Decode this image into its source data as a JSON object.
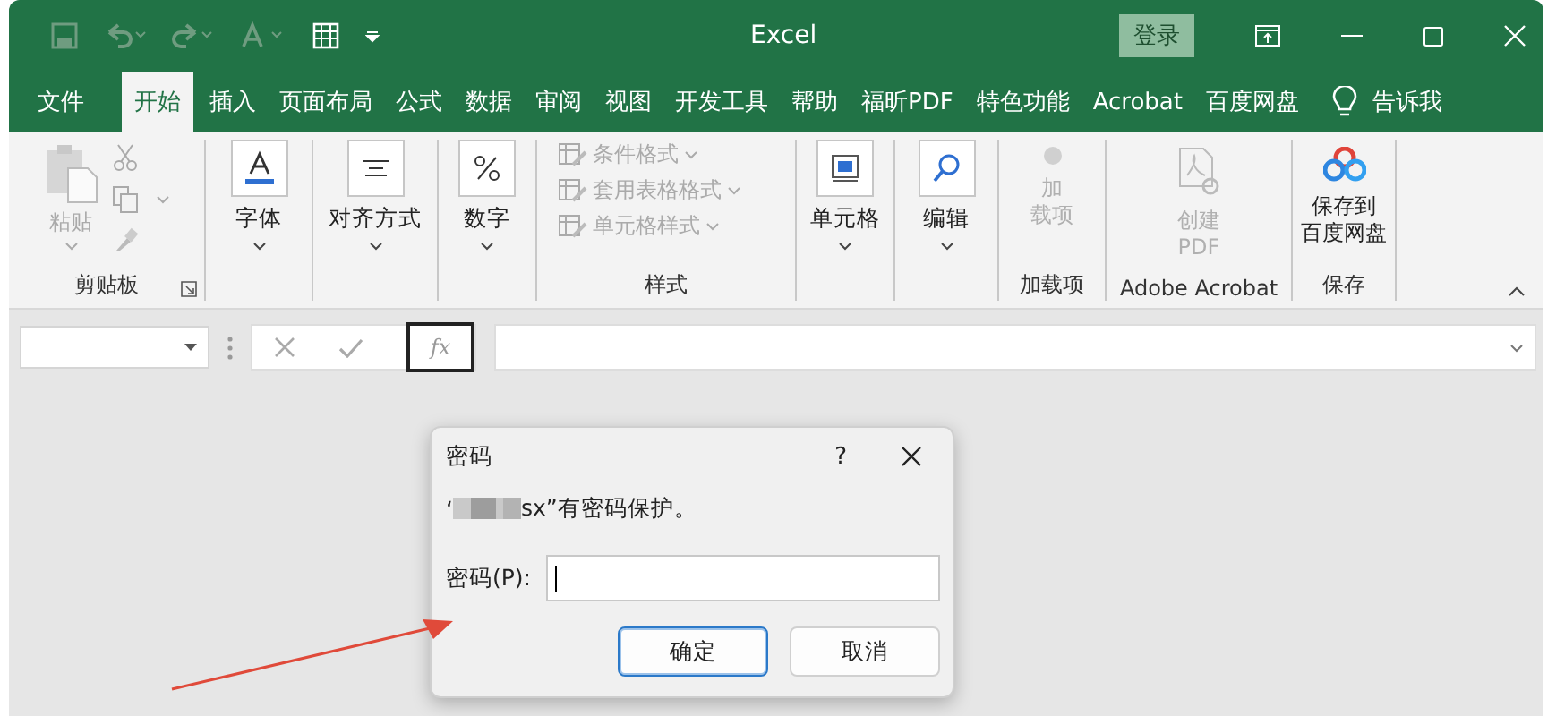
{
  "window": {
    "title": "Excel",
    "login": "登录"
  },
  "tabs": [
    {
      "label": "文件",
      "selected": false
    },
    {
      "label": "开始",
      "selected": true
    },
    {
      "label": "插入",
      "selected": false
    },
    {
      "label": "页面布局",
      "selected": false
    },
    {
      "label": "公式",
      "selected": false
    },
    {
      "label": "数据",
      "selected": false
    },
    {
      "label": "审阅",
      "selected": false
    },
    {
      "label": "视图",
      "selected": false
    },
    {
      "label": "开发工具",
      "selected": false
    },
    {
      "label": "帮助",
      "selected": false
    },
    {
      "label": "福昕PDF",
      "selected": false
    },
    {
      "label": "特色功能",
      "selected": false
    },
    {
      "label": "Acrobat",
      "selected": false
    },
    {
      "label": "百度网盘",
      "selected": false
    }
  ],
  "tell_me": "告诉我",
  "ribbon": {
    "groups": [
      {
        "kind": "clipboard",
        "label": "剪贴板",
        "paste": {
          "label": "粘贴",
          "disabled": true
        }
      },
      {
        "kind": "launcher",
        "button": "字体"
      },
      {
        "kind": "launcher",
        "button": "对齐方式"
      },
      {
        "kind": "launcher",
        "button": "数字"
      },
      {
        "kind": "list",
        "label": "样式",
        "items": [
          {
            "label": "条件格式",
            "disabled": true
          },
          {
            "label": "套用表格格式",
            "disabled": true
          },
          {
            "label": "单元格样式",
            "disabled": true
          }
        ]
      },
      {
        "kind": "launcher",
        "button": "单元格"
      },
      {
        "kind": "launcher",
        "button": "编辑"
      },
      {
        "kind": "large",
        "label": "加载项",
        "button": {
          "lines": [
            "加",
            "载项"
          ],
          "disabled": true
        }
      },
      {
        "kind": "large",
        "label": "Adobe Acrobat",
        "button": {
          "lines": [
            "创建",
            "PDF"
          ],
          "disabled": true
        }
      },
      {
        "kind": "large",
        "label": "保存",
        "button": {
          "lines": [
            "保存到",
            "百度网盘"
          ],
          "disabled": false
        }
      }
    ]
  },
  "formula_bar": {
    "fx": "fx"
  },
  "dialog": {
    "title": "密码",
    "help": "?",
    "quote": "‘",
    "message": "sx”有密码保护。",
    "field_label": "密码(P):",
    "buttons": [
      {
        "label": "确定",
        "selected": true
      },
      {
        "label": "取消",
        "selected": false
      }
    ]
  }
}
